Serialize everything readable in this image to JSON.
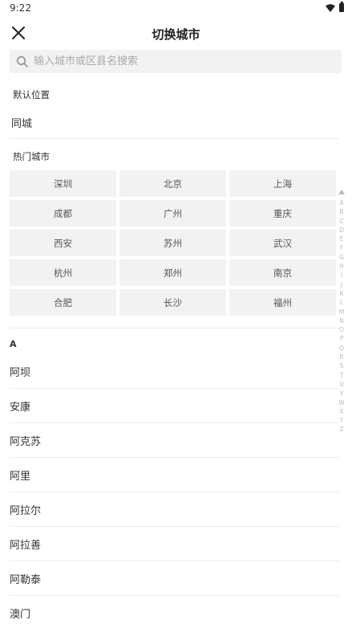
{
  "status": {
    "time": "9:22"
  },
  "nav": {
    "title": "切换城市"
  },
  "search": {
    "placeholder": "输入城市或区县名搜索"
  },
  "default_section": {
    "label": "默认位置",
    "city": "同城"
  },
  "hot_section": {
    "label": "热门城市",
    "cities": [
      "深圳",
      "北京",
      "上海",
      "成都",
      "广州",
      "重庆",
      "西安",
      "苏州",
      "武汉",
      "杭州",
      "郑州",
      "南京",
      "合肥",
      "长沙",
      "福州"
    ]
  },
  "list": {
    "letter": "A",
    "cities": [
      "阿坝",
      "安康",
      "阿克苏",
      "阿里",
      "阿拉尔",
      "阿拉善",
      "阿勒泰",
      "澳门"
    ]
  },
  "index": [
    "A",
    "B",
    "C",
    "D",
    "E",
    "F",
    "G",
    "H",
    "I",
    "J",
    "K",
    "L",
    "M",
    "N",
    "O",
    "P",
    "Q",
    "R",
    "S",
    "T",
    "U",
    "V",
    "W",
    "X",
    "Y",
    "Z"
  ]
}
